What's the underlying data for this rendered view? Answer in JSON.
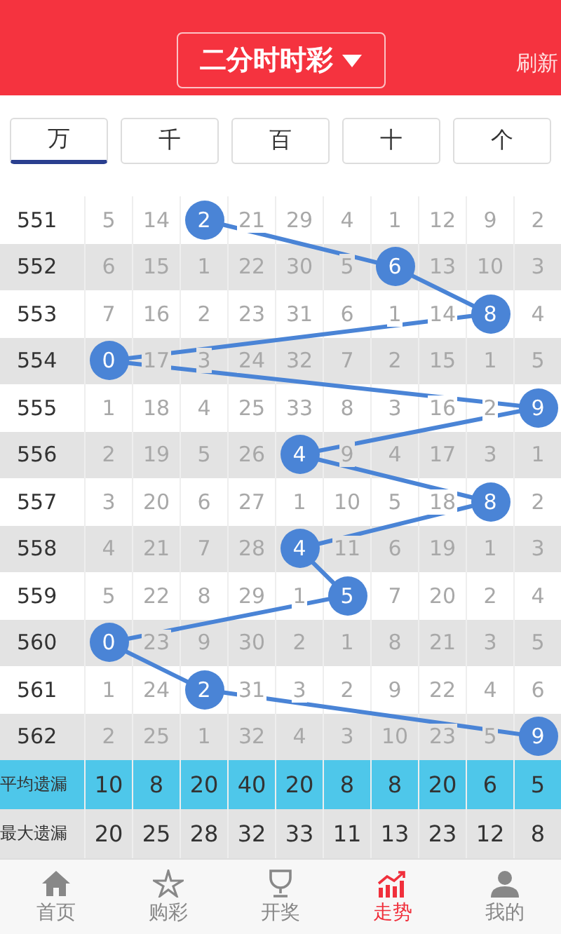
{
  "header": {
    "title": "二分时时彩",
    "refresh": "刷新"
  },
  "tabs": [
    {
      "label": "万",
      "selected": true
    },
    {
      "label": "千",
      "selected": false
    },
    {
      "label": "百",
      "selected": false
    },
    {
      "label": "十",
      "selected": false
    },
    {
      "label": "个",
      "selected": false
    }
  ],
  "rows": [
    {
      "issue": "551",
      "cells": [
        {
          "v": "5",
          "hit": false
        },
        {
          "v": "14",
          "hit": false
        },
        {
          "v": "2",
          "hit": true
        },
        {
          "v": "21",
          "hit": false
        },
        {
          "v": "29",
          "hit": false
        },
        {
          "v": "4",
          "hit": false
        },
        {
          "v": "1",
          "hit": false
        },
        {
          "v": "12",
          "hit": false
        },
        {
          "v": "9",
          "hit": false
        },
        {
          "v": "2",
          "hit": false
        }
      ]
    },
    {
      "issue": "552",
      "cells": [
        {
          "v": "6",
          "hit": false
        },
        {
          "v": "15",
          "hit": false
        },
        {
          "v": "1",
          "hit": false
        },
        {
          "v": "22",
          "hit": false
        },
        {
          "v": "30",
          "hit": false
        },
        {
          "v": "5",
          "hit": false
        },
        {
          "v": "6",
          "hit": true
        },
        {
          "v": "13",
          "hit": false
        },
        {
          "v": "10",
          "hit": false
        },
        {
          "v": "3",
          "hit": false
        }
      ]
    },
    {
      "issue": "553",
      "cells": [
        {
          "v": "7",
          "hit": false
        },
        {
          "v": "16",
          "hit": false
        },
        {
          "v": "2",
          "hit": false
        },
        {
          "v": "23",
          "hit": false
        },
        {
          "v": "31",
          "hit": false
        },
        {
          "v": "6",
          "hit": false
        },
        {
          "v": "1",
          "hit": false
        },
        {
          "v": "14",
          "hit": false
        },
        {
          "v": "8",
          "hit": true
        },
        {
          "v": "4",
          "hit": false
        }
      ]
    },
    {
      "issue": "554",
      "cells": [
        {
          "v": "0",
          "hit": true
        },
        {
          "v": "17",
          "hit": false
        },
        {
          "v": "3",
          "hit": false
        },
        {
          "v": "24",
          "hit": false
        },
        {
          "v": "32",
          "hit": false
        },
        {
          "v": "7",
          "hit": false
        },
        {
          "v": "2",
          "hit": false
        },
        {
          "v": "15",
          "hit": false
        },
        {
          "v": "1",
          "hit": false
        },
        {
          "v": "5",
          "hit": false
        }
      ]
    },
    {
      "issue": "555",
      "cells": [
        {
          "v": "1",
          "hit": false
        },
        {
          "v": "18",
          "hit": false
        },
        {
          "v": "4",
          "hit": false
        },
        {
          "v": "25",
          "hit": false
        },
        {
          "v": "33",
          "hit": false
        },
        {
          "v": "8",
          "hit": false
        },
        {
          "v": "3",
          "hit": false
        },
        {
          "v": "16",
          "hit": false
        },
        {
          "v": "2",
          "hit": false
        },
        {
          "v": "9",
          "hit": true
        }
      ]
    },
    {
      "issue": "556",
      "cells": [
        {
          "v": "2",
          "hit": false
        },
        {
          "v": "19",
          "hit": false
        },
        {
          "v": "5",
          "hit": false
        },
        {
          "v": "26",
          "hit": false
        },
        {
          "v": "4",
          "hit": true
        },
        {
          "v": "9",
          "hit": false
        },
        {
          "v": "4",
          "hit": false
        },
        {
          "v": "17",
          "hit": false
        },
        {
          "v": "3",
          "hit": false
        },
        {
          "v": "1",
          "hit": false
        }
      ]
    },
    {
      "issue": "557",
      "cells": [
        {
          "v": "3",
          "hit": false
        },
        {
          "v": "20",
          "hit": false
        },
        {
          "v": "6",
          "hit": false
        },
        {
          "v": "27",
          "hit": false
        },
        {
          "v": "1",
          "hit": false
        },
        {
          "v": "10",
          "hit": false
        },
        {
          "v": "5",
          "hit": false
        },
        {
          "v": "18",
          "hit": false
        },
        {
          "v": "8",
          "hit": true
        },
        {
          "v": "2",
          "hit": false
        }
      ]
    },
    {
      "issue": "558",
      "cells": [
        {
          "v": "4",
          "hit": false
        },
        {
          "v": "21",
          "hit": false
        },
        {
          "v": "7",
          "hit": false
        },
        {
          "v": "28",
          "hit": false
        },
        {
          "v": "4",
          "hit": true
        },
        {
          "v": "11",
          "hit": false
        },
        {
          "v": "6",
          "hit": false
        },
        {
          "v": "19",
          "hit": false
        },
        {
          "v": "1",
          "hit": false
        },
        {
          "v": "3",
          "hit": false
        }
      ]
    },
    {
      "issue": "559",
      "cells": [
        {
          "v": "5",
          "hit": false
        },
        {
          "v": "22",
          "hit": false
        },
        {
          "v": "8",
          "hit": false
        },
        {
          "v": "29",
          "hit": false
        },
        {
          "v": "1",
          "hit": false
        },
        {
          "v": "5",
          "hit": true
        },
        {
          "v": "7",
          "hit": false
        },
        {
          "v": "20",
          "hit": false
        },
        {
          "v": "2",
          "hit": false
        },
        {
          "v": "4",
          "hit": false
        }
      ]
    },
    {
      "issue": "560",
      "cells": [
        {
          "v": "0",
          "hit": true
        },
        {
          "v": "23",
          "hit": false
        },
        {
          "v": "9",
          "hit": false
        },
        {
          "v": "30",
          "hit": false
        },
        {
          "v": "2",
          "hit": false
        },
        {
          "v": "1",
          "hit": false
        },
        {
          "v": "8",
          "hit": false
        },
        {
          "v": "21",
          "hit": false
        },
        {
          "v": "3",
          "hit": false
        },
        {
          "v": "5",
          "hit": false
        }
      ]
    },
    {
      "issue": "561",
      "cells": [
        {
          "v": "1",
          "hit": false
        },
        {
          "v": "24",
          "hit": false
        },
        {
          "v": "2",
          "hit": true
        },
        {
          "v": "31",
          "hit": false
        },
        {
          "v": "3",
          "hit": false
        },
        {
          "v": "2",
          "hit": false
        },
        {
          "v": "9",
          "hit": false
        },
        {
          "v": "22",
          "hit": false
        },
        {
          "v": "4",
          "hit": false
        },
        {
          "v": "6",
          "hit": false
        }
      ]
    },
    {
      "issue": "562",
      "cells": [
        {
          "v": "2",
          "hit": false
        },
        {
          "v": "25",
          "hit": false
        },
        {
          "v": "1",
          "hit": false
        },
        {
          "v": "32",
          "hit": false
        },
        {
          "v": "4",
          "hit": false
        },
        {
          "v": "3",
          "hit": false
        },
        {
          "v": "10",
          "hit": false
        },
        {
          "v": "23",
          "hit": false
        },
        {
          "v": "5",
          "hit": false
        },
        {
          "v": "9",
          "hit": true
        }
      ]
    }
  ],
  "stats": [
    {
      "kind": "average",
      "label": "平均遗漏",
      "values": [
        "10",
        "8",
        "20",
        "40",
        "20",
        "8",
        "8",
        "20",
        "6",
        "5"
      ]
    },
    {
      "kind": "max",
      "label": "最大遗漏",
      "values": [
        "20",
        "25",
        "28",
        "32",
        "33",
        "11",
        "13",
        "23",
        "12",
        "8"
      ]
    }
  ],
  "nav": [
    {
      "kind": "home",
      "label": "首页",
      "selected": false
    },
    {
      "kind": "buy",
      "label": "购彩",
      "selected": false
    },
    {
      "kind": "draw",
      "label": "开奖",
      "selected": false
    },
    {
      "kind": "trend",
      "label": "走势",
      "selected": true
    },
    {
      "kind": "me",
      "label": "我的",
      "selected": false
    }
  ]
}
